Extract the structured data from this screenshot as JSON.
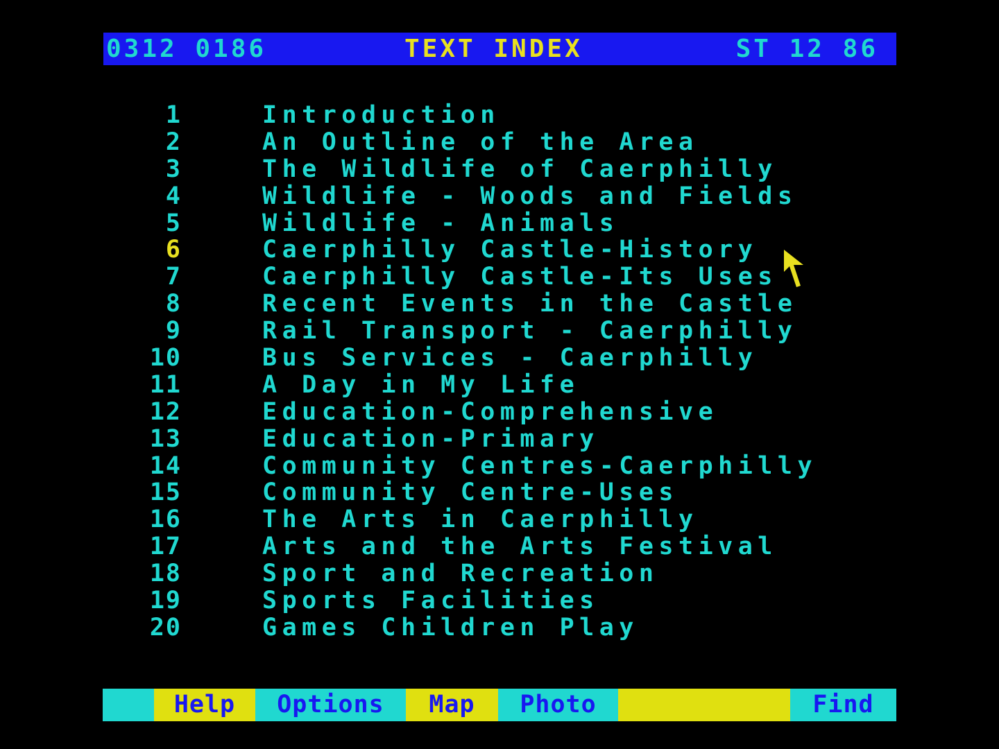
{
  "header": {
    "page_code": "0312 0186",
    "title": "TEXT INDEX",
    "code_right": "ST 12 86",
    "background_color": "#1818f0"
  },
  "index": {
    "selected_number": "6",
    "items": [
      {
        "number": "1",
        "title": "Introduction"
      },
      {
        "number": "2",
        "title": "An Outline of the Area"
      },
      {
        "number": "3",
        "title": "The Wildlife of Caerphilly"
      },
      {
        "number": "4",
        "title": "Wildlife - Woods and Fields"
      },
      {
        "number": "5",
        "title": "Wildlife - Animals"
      },
      {
        "number": "6",
        "title": "Caerphilly Castle-History"
      },
      {
        "number": "7",
        "title": "Caerphilly Castle-Its Uses"
      },
      {
        "number": "8",
        "title": "Recent Events in the Castle"
      },
      {
        "number": "9",
        "title": "Rail Transport - Caerphilly"
      },
      {
        "number": "10",
        "title": "Bus Services - Caerphilly"
      },
      {
        "number": "11",
        "title": "A Day in My Life"
      },
      {
        "number": "12",
        "title": "Education-Comprehensive"
      },
      {
        "number": "13",
        "title": "Education-Primary"
      },
      {
        "number": "14",
        "title": "Community Centres-Caerphilly"
      },
      {
        "number": "15",
        "title": "Community Centre-Uses"
      },
      {
        "number": "16",
        "title": "The Arts in Caerphilly"
      },
      {
        "number": "17",
        "title": "Arts and the Arts Festival"
      },
      {
        "number": "18",
        "title": "Sport and Recreation"
      },
      {
        "number": "19",
        "title": "Sports Facilities"
      },
      {
        "number": "20",
        "title": "Games Children Play"
      }
    ]
  },
  "pointer": {
    "icon": "arrow-pointer-icon",
    "color": "#e8e020"
  },
  "footer": {
    "back_icon": "back-arrow-icon",
    "help": "Help",
    "options": "Options",
    "map": "Map",
    "photo": "Photo",
    "blank": "",
    "find": "Find"
  },
  "colors": {
    "background": "#000000",
    "text_cyan": "#20d8d0",
    "text_yellow": "#e8e020",
    "key_yellow": "#e0e010",
    "key_text_blue": "#1818f0"
  }
}
